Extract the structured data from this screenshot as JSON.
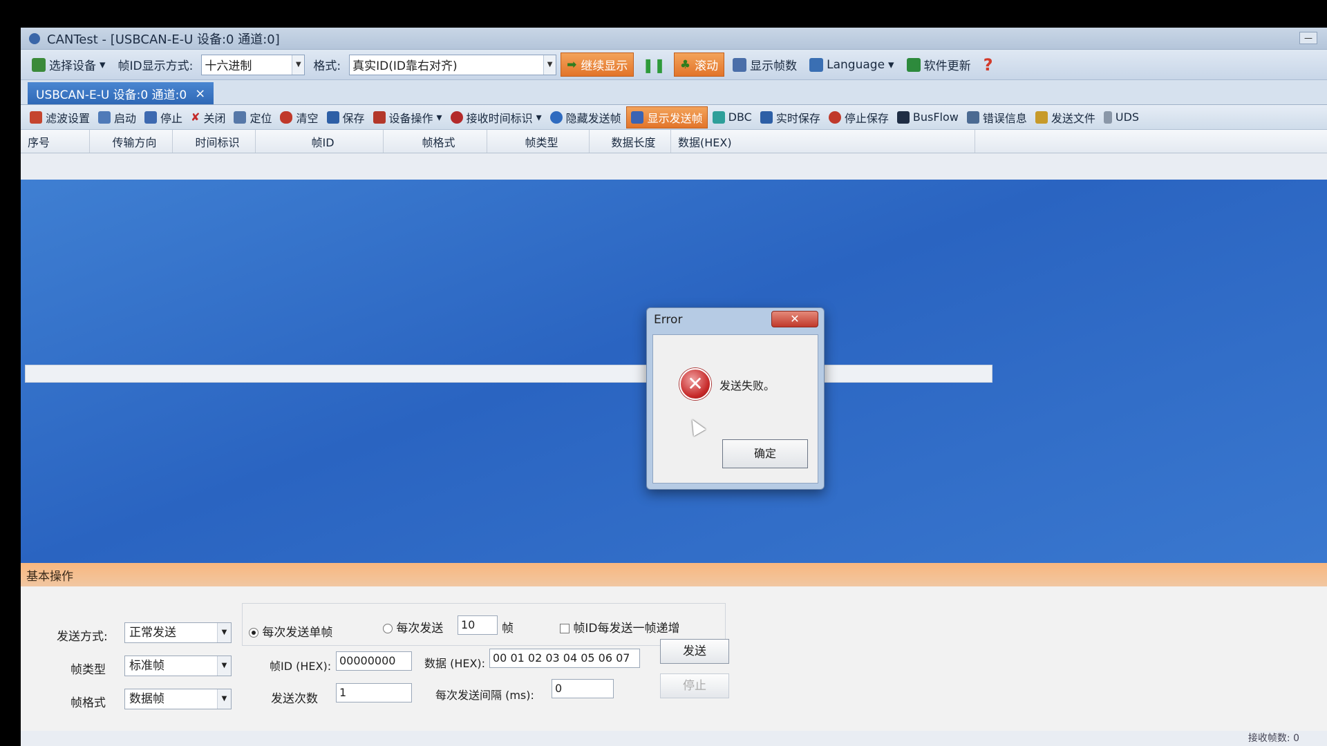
{
  "window": {
    "title": "CANTest - [USBCAN-E-U 设备:0 通道:0]",
    "min_label": "—"
  },
  "toolbar1": {
    "select_device": "选择设备",
    "frame_id_display_label": "帧ID显示方式:",
    "frame_id_display_value": "十六进制",
    "format_label": "格式:",
    "format_value": "真实ID(ID靠右对齐)",
    "continue_display": "继续显示",
    "scroll": "滚动",
    "show_frame_count": "显示帧数",
    "language": "Language",
    "software_update": "软件更新"
  },
  "tab": {
    "label": "USBCAN-E-U 设备:0 通道:0",
    "close": "×"
  },
  "toolbar2": {
    "filter": "滤波设置",
    "start": "启动",
    "stop": "停止",
    "close": "关闭",
    "locate": "定位",
    "clear": "清空",
    "save": "保存",
    "device_op": "设备操作",
    "recv_time": "接收时间标识",
    "hide_send": "隐藏发送帧",
    "show_send": "显示发送帧",
    "dbc": "DBC",
    "realtime_save": "实时保存",
    "stop_save": "停止保存",
    "busflow": "BusFlow",
    "error_info": "错误信息",
    "send_file": "发送文件",
    "uds": "UDS"
  },
  "columns": [
    "序号",
    "传输方向",
    "时间标识",
    "帧ID",
    "帧格式",
    "帧类型",
    "数据长度",
    "数据(HEX)"
  ],
  "panel": {
    "title": "基本操作",
    "send_mode_label": "发送方式:",
    "send_mode_value": "正常发送",
    "frame_type_label": "帧类型",
    "frame_type_value": "标准帧",
    "frame_format_label": "帧格式",
    "frame_format_value": "数据帧",
    "radio_single": "每次发送单帧",
    "radio_multi": "每次发送",
    "multi_count": "10",
    "multi_unit": "帧",
    "increment_label": "帧ID每发送一帧递增",
    "frame_id_label": "帧ID (HEX):",
    "frame_id_value": "00000000",
    "data_label": "数据 (HEX):",
    "data_value": "00 01 02 03 04 05 06 07",
    "send_count_label": "发送次数",
    "send_count_value": "1",
    "interval_label": "每次发送间隔 (ms):",
    "interval_value": "0",
    "send_button": "发送",
    "stop_button": "停止"
  },
  "status": {
    "text": "接收帧数: 0"
  },
  "dialog": {
    "title": "Error",
    "close": "✕",
    "message": "发送失败。",
    "ok": "确定",
    "icon": "error-icon"
  }
}
